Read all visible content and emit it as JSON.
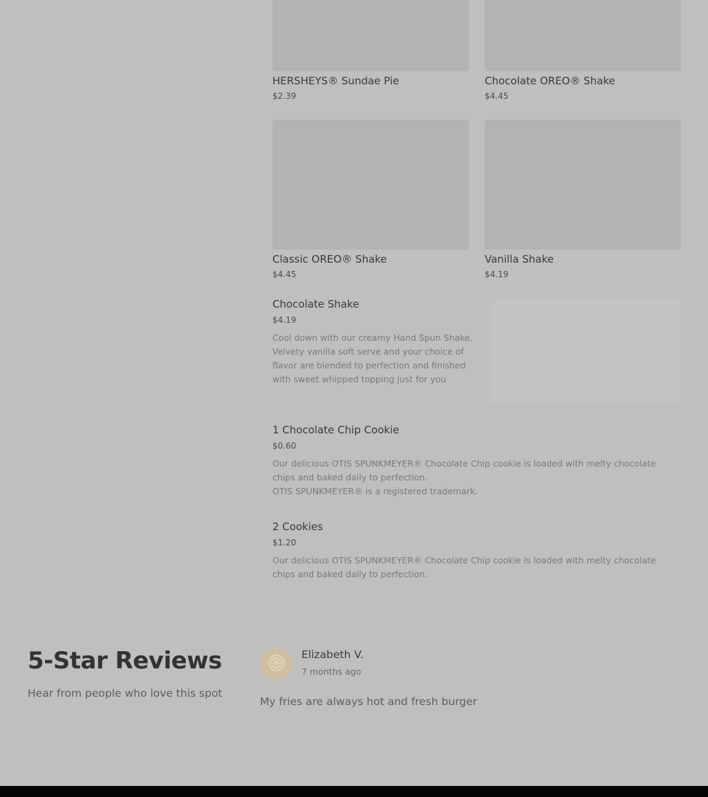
{
  "menu_grid": [
    {
      "name": "HERSHEYS® Sundae Pie",
      "price": "$2.39"
    },
    {
      "name": "Chocolate OREO® Shake",
      "price": "$4.45"
    },
    {
      "name": "Classic OREO® Shake",
      "price": "$4.45"
    },
    {
      "name": "Vanilla Shake",
      "price": "$4.19"
    }
  ],
  "menu_list": [
    {
      "name": "Chocolate Shake",
      "price": "$4.19",
      "description": "Cool down with our creamy Hand Spun Shake.\nVelvety vanilla soft serve and your choice of\nflavor are blended to perfection and finished\nwith sweet whipped topping just for you"
    },
    {
      "name": "1 Chocolate Chip Cookie",
      "price": "$0.60",
      "description": "Our delicious OTIS SPUNKMEYER® Chocolate Chip cookie is loaded with melty chocolate\nchips and baked daily to perfection.\nOTIS SPUNKMEYER® is a registered trademark."
    },
    {
      "name": "2 Cookies",
      "price": "$1.20",
      "description": "Our delicious OTIS SPUNKMEYER® Chocolate Chip cookie is loaded with melty chocolate\nchips and baked daily to perfection."
    }
  ],
  "reviews": {
    "title": "5-Star Reviews",
    "subtitle": "Hear from people who love this spot",
    "items": [
      {
        "avatar_icon": "citrus-slice-icon",
        "name": "Elizabeth V.",
        "time": "7 months ago",
        "text": "My fries are always hot and fresh burger"
      }
    ]
  },
  "colors": {
    "background": "#bfbfbf",
    "thumb": "#b3b3b3",
    "avatar": "#cdbf9f",
    "footer": "#050505"
  }
}
